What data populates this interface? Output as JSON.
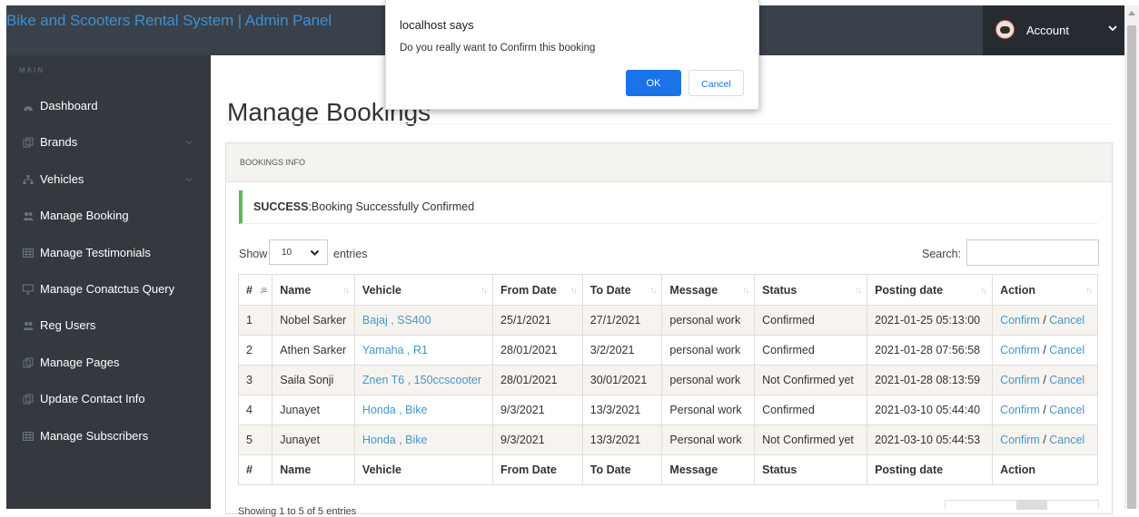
{
  "header": {
    "brand": "Bike and Scooters Rental System | Admin Panel",
    "account_label": "Account"
  },
  "sidebar": {
    "section_title": "MAIN",
    "items": [
      {
        "label": "Dashboard",
        "icon": "dashboard-icon",
        "has_caret": false
      },
      {
        "label": "Brands",
        "icon": "files-icon",
        "has_caret": true
      },
      {
        "label": "Vehicles",
        "icon": "sitemap-icon",
        "has_caret": true
      },
      {
        "label": "Manage Booking",
        "icon": "users-icon",
        "has_caret": false
      },
      {
        "label": "Manage Testimonials",
        "icon": "table-icon",
        "has_caret": false
      },
      {
        "label": "Manage Conatctus Query",
        "icon": "desktop-icon",
        "has_caret": false
      },
      {
        "label": "Reg Users",
        "icon": "users-icon",
        "has_caret": false
      },
      {
        "label": "Manage Pages",
        "icon": "files-icon",
        "has_caret": false
      },
      {
        "label": "Update Contact Info",
        "icon": "files-icon",
        "has_caret": false
      },
      {
        "label": "Manage Subscribers",
        "icon": "table-icon",
        "has_caret": false
      }
    ]
  },
  "main": {
    "page_title": "Manage Bookings",
    "panel_heading": "BOOKINGS INFO",
    "alert": {
      "strong": "SUCCESS",
      "message": ":Booking Successfully Confirmed"
    },
    "length": {
      "show": "Show",
      "value": "10",
      "entries": "entries"
    },
    "search_label": "Search:",
    "table": {
      "columns": [
        "#",
        "Name",
        "Vehicle",
        "From Date",
        "To Date",
        "Message",
        "Status",
        "Posting date",
        "Action"
      ],
      "rows": [
        {
          "num": "1",
          "name": "Nobel Sarker",
          "vehicle": "Bajaj , SS400",
          "from": "25/1/2021",
          "to": "27/1/2021",
          "message": "personal work",
          "status": "Confirmed",
          "posted": "2021-01-25 05:13:00"
        },
        {
          "num": "2",
          "name": "Athen Sarker",
          "vehicle": "Yamaha , R1",
          "from": "28/01/2021",
          "to": "3/2/2021",
          "message": "personal work",
          "status": "Confirmed",
          "posted": "2021-01-28 07:56:58"
        },
        {
          "num": "3",
          "name": "Saila Sonji",
          "vehicle": "Znen T6 , 150ccscooter",
          "from": "28/01/2021",
          "to": "30/01/2021",
          "message": "personal work",
          "status": "Not Confirmed yet",
          "posted": "2021-01-28 08:13:59"
        },
        {
          "num": "4",
          "name": "Junayet",
          "vehicle": "Honda , Bike",
          "from": "9/3/2021",
          "to": "13/3/2021",
          "message": "Personal work",
          "status": "Confirmed",
          "posted": "2021-03-10 05:44:40"
        },
        {
          "num": "5",
          "name": "Junayet",
          "vehicle": "Honda , Bike",
          "from": "9/3/2021",
          "to": "13/3/2021",
          "message": "Personal work",
          "status": "Not Confirmed yet",
          "posted": "2021-03-10 05:44:53"
        }
      ],
      "action_confirm": "Confirm",
      "action_sep": " / ",
      "action_cancel": "Cancel"
    },
    "footer_info": "Showing 1 to 5 of 5 entries"
  },
  "dialog": {
    "title": "localhost says",
    "message": "Do you really want to Confirm this booking",
    "ok_label": "OK",
    "cancel_label": "Cancel"
  },
  "colors": {
    "topbar": "#3a414a",
    "sidebar": "#33393f",
    "brand_link": "#3f8fd2",
    "dialog_primary": "#1a73e8",
    "success_border": "#5cb85c"
  }
}
